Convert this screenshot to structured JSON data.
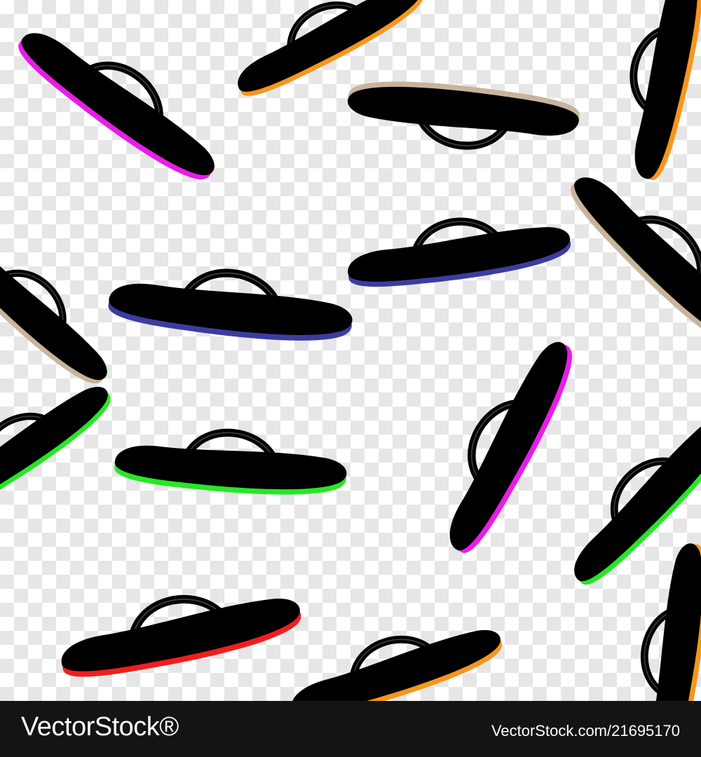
{
  "footer": {
    "brand": "VectorStock®",
    "image_id": "VectorStock.com/21695170"
  },
  "colors": {
    "footer_bg": "#141414",
    "checker_light": "#ffffff",
    "checker_dark": "#e6e6e6",
    "sandal_body": "#000000",
    "sole_magenta": "#e61ee6",
    "sole_orange": "#f5961e",
    "sole_beige": "#c8b49b",
    "sole_blue": "#3c3ca0",
    "sole_green": "#28e628",
    "sole_red": "#f01e1e"
  },
  "sandals": [
    {
      "name": "sandal-magenta-top-left",
      "sole": "magenta"
    },
    {
      "name": "sandal-orange-top",
      "sole": "orange"
    },
    {
      "name": "sandal-beige-top",
      "sole": "beige"
    },
    {
      "name": "sandal-orange-top-right",
      "sole": "orange"
    },
    {
      "name": "sandal-beige-left",
      "sole": "beige"
    },
    {
      "name": "sandal-blue-center-left",
      "sole": "blue"
    },
    {
      "name": "sandal-blue-center-right",
      "sole": "blue"
    },
    {
      "name": "sandal-beige-right",
      "sole": "beige"
    },
    {
      "name": "sandal-green-left-edge",
      "sole": "green"
    },
    {
      "name": "sandal-green-center",
      "sole": "green"
    },
    {
      "name": "sandal-magenta-right",
      "sole": "magenta"
    },
    {
      "name": "sandal-green-right-edge",
      "sole": "green"
    },
    {
      "name": "sandal-red-bottom",
      "sole": "red"
    },
    {
      "name": "sandal-orange-bottom",
      "sole": "orange"
    },
    {
      "name": "sandal-orange-bottom-right",
      "sole": "orange"
    }
  ]
}
